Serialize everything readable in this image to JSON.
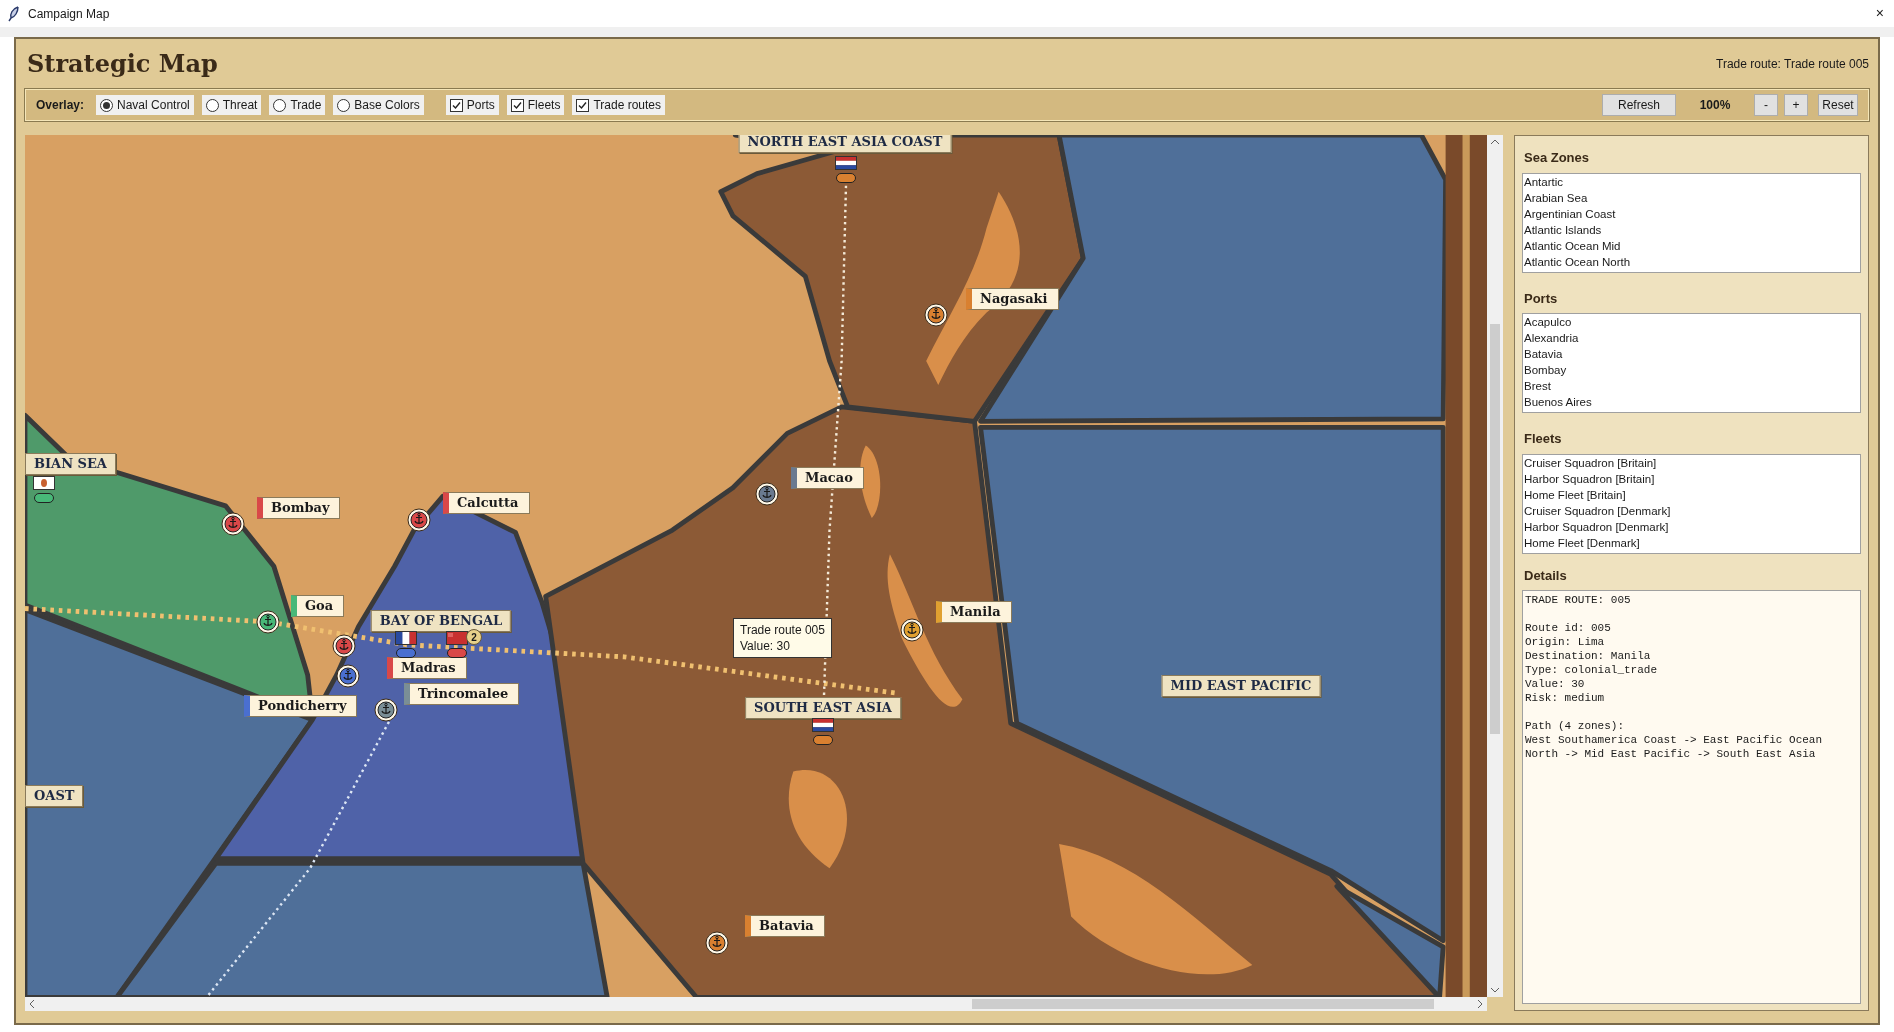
{
  "window": {
    "title": "Campaign Map",
    "close": "×"
  },
  "header": {
    "title": "Strategic Map",
    "status": "Trade route: Trade route 005"
  },
  "toolbar": {
    "overlay_label": "Overlay:",
    "overlays": [
      {
        "label": "Naval Control",
        "selected": true
      },
      {
        "label": "Threat",
        "selected": false
      },
      {
        "label": "Trade",
        "selected": false
      },
      {
        "label": "Base Colors",
        "selected": false
      }
    ],
    "toggles": [
      {
        "label": "Ports",
        "checked": true
      },
      {
        "label": "Fleets",
        "checked": true
      },
      {
        "label": "Trade routes",
        "checked": true
      }
    ],
    "refresh": "Refresh",
    "zoom": "100%",
    "zoom_out": "-",
    "zoom_in": "+",
    "reset": "Reset"
  },
  "map": {
    "zone_labels": [
      "NORTH EAST ASIA COAST",
      "BIAN SEA",
      "BAY OF BENGAL",
      "SOUTH EAST ASIA",
      "MID EAST PACIFIC",
      "OAST"
    ],
    "ports": [
      {
        "name": "Bombay",
        "color": "#d94848"
      },
      {
        "name": "Calcutta",
        "color": "#d94848"
      },
      {
        "name": "Goa",
        "color": "#48b878"
      },
      {
        "name": "Madras",
        "color": "#d94848"
      },
      {
        "name": "Pondicherry",
        "color": "#4a6fd0"
      },
      {
        "name": "Trincomalee",
        "color": "#7a8e96"
      },
      {
        "name": "Macao",
        "color": "#6a7a90"
      },
      {
        "name": "Nagasaki",
        "color": "#d98030"
      },
      {
        "name": "Manila",
        "color": "#e0a030"
      },
      {
        "name": "Batavia",
        "color": "#d98030"
      }
    ],
    "fleets": [
      {
        "kind": "emblem",
        "color": "#48b878"
      },
      {
        "kind": "vertical",
        "color": "#4a6fd0"
      },
      {
        "kind": "red",
        "color": "#d94848",
        "badge": "2"
      },
      {
        "kind": "horizontal",
        "color": "#d98030"
      },
      {
        "kind": "horizontal",
        "color": "#d98030"
      }
    ],
    "tooltip": [
      "Trade route 005",
      "Value: 30"
    ]
  },
  "sidebar": {
    "sections": [
      {
        "title": "Sea Zones",
        "items": [
          "Antartic",
          "Arabian Sea",
          "Argentinian Coast",
          "Atlantic Islands",
          "Atlantic Ocean Mid",
          "Atlantic Ocean North"
        ]
      },
      {
        "title": "Ports",
        "items": [
          "Acapulco",
          "Alexandria",
          "Batavia",
          "Bombay",
          "Brest",
          "Buenos Aires"
        ]
      },
      {
        "title": "Fleets",
        "items": [
          "Cruiser Squadron [Britain]",
          "Harbor Squadron [Britain]",
          "Home Fleet [Britain]",
          "Cruiser Squadron [Denmark]",
          "Harbor Squadron [Denmark]",
          "Home Fleet [Denmark]"
        ]
      }
    ],
    "details": {
      "title": "Details",
      "blocks": [
        [
          "TRADE ROUTE: 005"
        ],
        [
          "Route id: 005",
          "Origin: Lima",
          "Destination: Manila",
          "Type: colonial_trade",
          "Value: 30",
          "Risk: medium"
        ],
        [
          "Path (4 zones):",
          "West Southamerica Coast -> East Pacific Ocean North -> Mid East Pacific -> South East Asia"
        ]
      ]
    }
  }
}
